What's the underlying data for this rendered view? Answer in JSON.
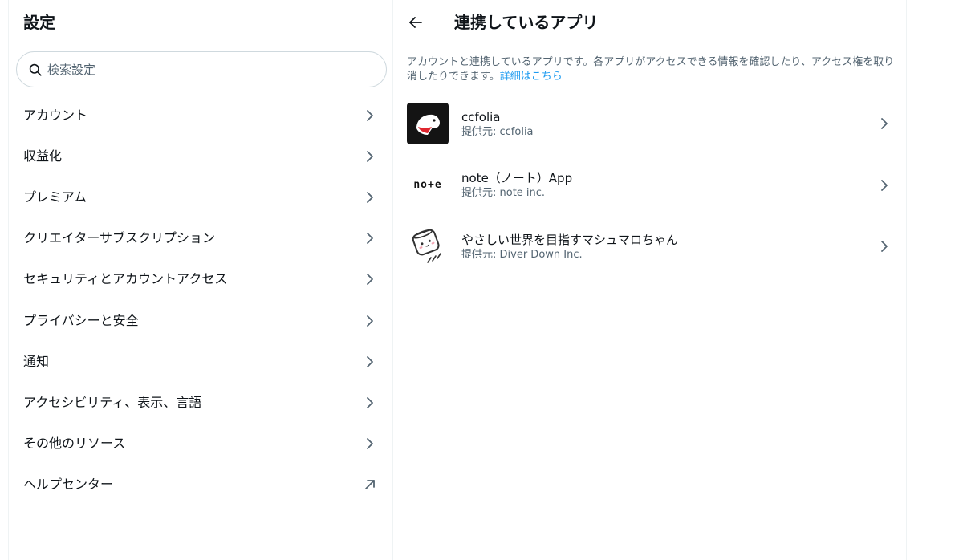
{
  "settings": {
    "title": "設定",
    "search": {
      "placeholder": "検索設定",
      "value": ""
    },
    "items": [
      {
        "label": "アカウント",
        "icon": "chevron-right-icon"
      },
      {
        "label": "収益化",
        "icon": "chevron-right-icon"
      },
      {
        "label": "プレミアム",
        "icon": "chevron-right-icon"
      },
      {
        "label": "クリエイターサブスクリプション",
        "icon": "chevron-right-icon"
      },
      {
        "label": "セキュリティとアカウントアクセス",
        "icon": "chevron-right-icon"
      },
      {
        "label": "プライバシーと安全",
        "icon": "chevron-right-icon"
      },
      {
        "label": "通知",
        "icon": "chevron-right-icon"
      },
      {
        "label": "アクセシビリティ、表示、言語",
        "icon": "chevron-right-icon"
      },
      {
        "label": "その他のリソース",
        "icon": "chevron-right-icon"
      },
      {
        "label": "ヘルプセンター",
        "icon": "external-link-arrow-icon"
      }
    ]
  },
  "detail": {
    "title": "連携しているアプリ",
    "description": "アカウントと連携しているアプリです。各アプリがアクセスできる情報を確認したり、アクセス権を取り消したりできます。",
    "details_link": "詳細はこちら",
    "apps": [
      {
        "name": "ccfolia",
        "provider": "提供元: ccfolia",
        "logo": "ccfolia-bird-icon"
      },
      {
        "name": "note（ノート）App",
        "provider": "提供元: note inc.",
        "logo": "note-wordmark",
        "logo_text": "no+e"
      },
      {
        "name": "やさしい世界を目指すマシュマロちゃん",
        "provider": "提供元: Diver Down Inc.",
        "logo": "marshmallow-icon"
      }
    ]
  },
  "colors": {
    "text": "#0f1419",
    "secondary": "#536471",
    "link": "#1d9bf0",
    "border": "#eff3f4"
  }
}
